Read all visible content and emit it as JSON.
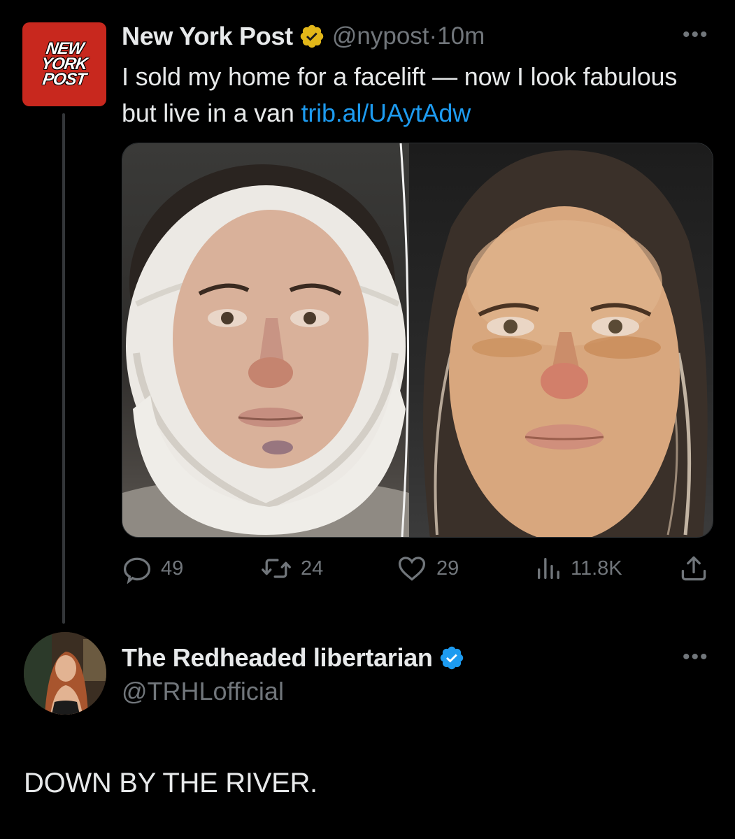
{
  "post": {
    "author_name": "New York Post",
    "handle": "@nypost",
    "separator": "·",
    "time": "10m",
    "logo_lines": [
      "NEW",
      "YORK",
      "POST"
    ],
    "text": "I sold my home for a facelift — now I look fabulous but live in a van ",
    "link": "trib.al/UAytAdw",
    "verified_badge": "gold",
    "actions": {
      "replies": "49",
      "reposts": "24",
      "likes": "29",
      "views": "11.8K"
    }
  },
  "reply": {
    "author_name": "The Redheaded libertarian",
    "handle": "@TRHLofficial",
    "verified_badge": "blue",
    "text": "DOWN BY THE RIVER."
  },
  "icons": {
    "more": "more-options-icon",
    "reply": "reply-bubble-icon",
    "repost": "repost-icon",
    "like": "heart-icon",
    "views": "views-bars-icon",
    "share": "share-upload-icon"
  },
  "colors": {
    "background": "#000000",
    "text": "#e7e9ea",
    "muted": "#71767b",
    "link": "#1d9bf0",
    "gold_badge": "#e2b719",
    "blue_badge": "#1d9bf0",
    "nyp_red": "#c8281e"
  }
}
